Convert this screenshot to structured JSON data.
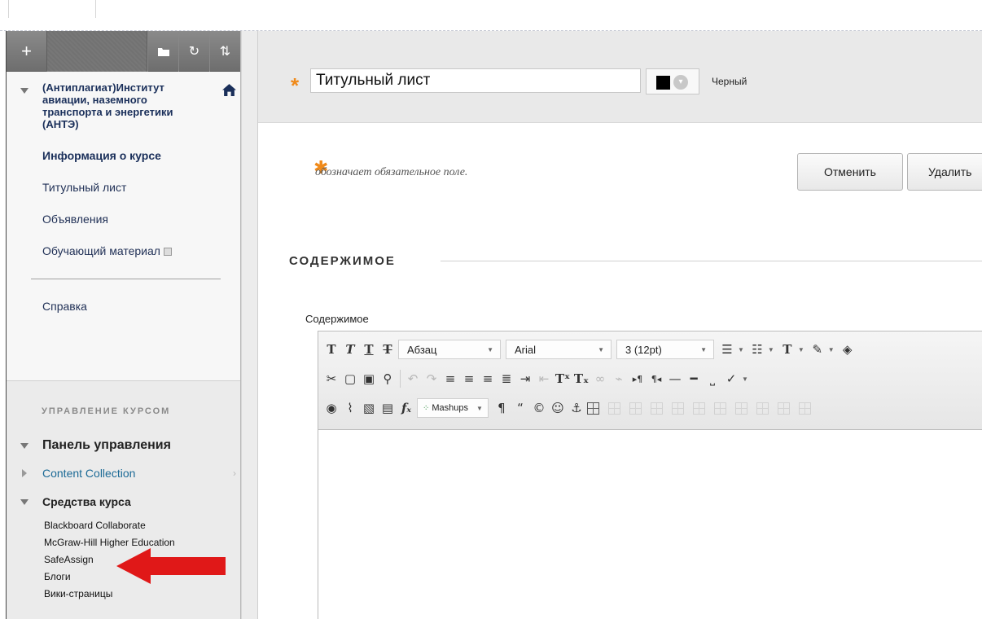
{
  "sidebar": {
    "toolbar": {
      "add_icon": "+",
      "folder_icon": "folder-icon",
      "refresh_icon": "↻",
      "sort_icon": "⇅"
    },
    "course_title": "(Антиплагиат)Институт авиации, наземного транспорта и энергетики (АНТЭ)",
    "items": [
      {
        "label": "Информация о курсе"
      },
      {
        "label": "Титульный лист"
      },
      {
        "label": "Объявления"
      },
      {
        "label": "Обучающий материал"
      },
      {
        "label": "Справка"
      }
    ],
    "management": {
      "title": "УПРАВЛЕНИЕ КУРСОМ",
      "control_panel": "Панель управления",
      "content_collection": "Content Collection",
      "course_tools": "Средства курса",
      "tools": [
        "Blackboard Collaborate",
        "McGraw-Hill Higher Education",
        "SafeAssign",
        "Блоги",
        "Вики-страницы"
      ]
    }
  },
  "main": {
    "title_value": "Титульный лист",
    "color_name": "Черный",
    "color_value": "#000000",
    "required_note": "обозначает обязательное поле.",
    "cancel_label": "Отменить",
    "delete_label": "Удалить",
    "section_title": "СОДЕРЖИМОЕ",
    "content_label": "Содержимое",
    "editor": {
      "paragraph": "Абзац",
      "font": "Arial",
      "size": "3 (12pt)",
      "mashups": "Mashups"
    }
  },
  "colors": {
    "accent_star": "#f08a1a",
    "annotation_arrow": "#e01818"
  }
}
